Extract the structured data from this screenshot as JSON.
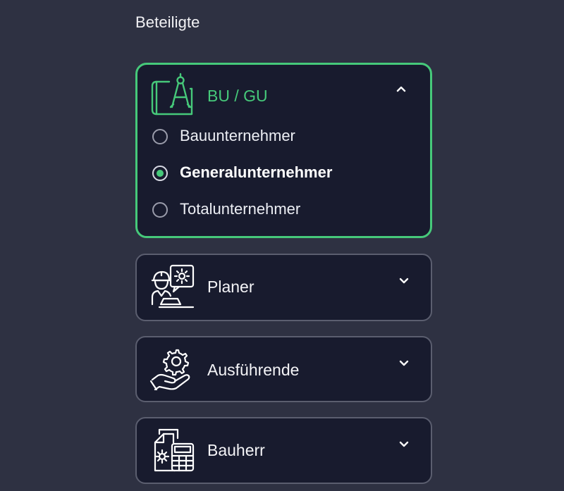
{
  "section": {
    "title": "Beteiligte"
  },
  "colors": {
    "background": "#2e3142",
    "card_background": "#181b2e",
    "accent": "#46c97a",
    "card_border": "#5b5e6f"
  },
  "cards": [
    {
      "label": "BU / GU",
      "icon": "blueprint-compass-icon",
      "expanded": true,
      "chevron": "chevron-up-icon",
      "options": [
        {
          "label": "Bauunternehmer",
          "selected": false
        },
        {
          "label": "Generalunternehmer",
          "selected": true
        },
        {
          "label": "Totalunternehmer",
          "selected": false
        }
      ]
    },
    {
      "label": "Planer",
      "icon": "engineer-planner-icon",
      "expanded": false,
      "chevron": "chevron-down-icon"
    },
    {
      "label": "Ausführende",
      "icon": "hand-gear-icon",
      "expanded": false,
      "chevron": "chevron-down-icon"
    },
    {
      "label": "Bauherr",
      "icon": "documents-calculator-icon",
      "expanded": false,
      "chevron": "chevron-down-icon"
    }
  ]
}
